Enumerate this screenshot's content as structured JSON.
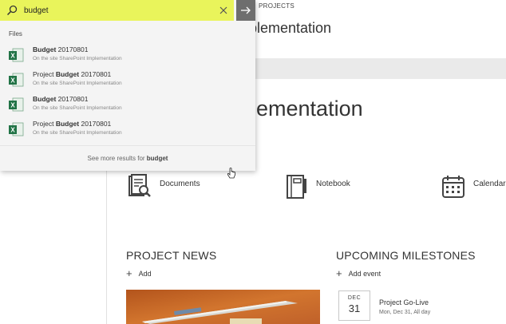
{
  "breadcrumb": "PROJECTS",
  "site_title_partial": "plementation",
  "hero_title_partial": "plementation",
  "quick_links": [
    {
      "label": "Documents",
      "icon": "documents-icon"
    },
    {
      "label": "Notebook",
      "icon": "notebook-icon"
    },
    {
      "label": "Calendar",
      "icon": "calendar-icon"
    }
  ],
  "news": {
    "title": "PROJECT NEWS",
    "add_label": "Add"
  },
  "milestones": {
    "title": "UPCOMING MILESTONES",
    "add_label": "Add event",
    "event": {
      "month": "DEC",
      "day": "31",
      "title": "Project Go-Live",
      "subtitle": "Mon, Dec 31, All day"
    }
  },
  "search": {
    "query": "budget",
    "group_label": "Files",
    "results": [
      {
        "prefix": "",
        "bold": "Budget",
        "suffix": " 20170801",
        "site": "On the site SharePoint Implementation",
        "icon": "excel-icon"
      },
      {
        "prefix": "Project ",
        "bold": "Budget",
        "suffix": " 20170801",
        "site": "On the site SharePoint Implementation",
        "icon": "excel-icon"
      },
      {
        "prefix": "",
        "bold": "Budget",
        "suffix": " 20170801",
        "site": "On the site SharePoint Implementation",
        "icon": "excel-icon"
      },
      {
        "prefix": "Project ",
        "bold": "Budget",
        "suffix": " 20170801",
        "site": "On the site SharePoint Implementation",
        "icon": "excel-icon"
      }
    ],
    "see_more_prefix": "See more results for ",
    "see_more_query": "budget"
  },
  "colors": {
    "search_highlight": "#e9f45b",
    "excel_green": "#217346",
    "go_button": "#6e6e6e"
  }
}
